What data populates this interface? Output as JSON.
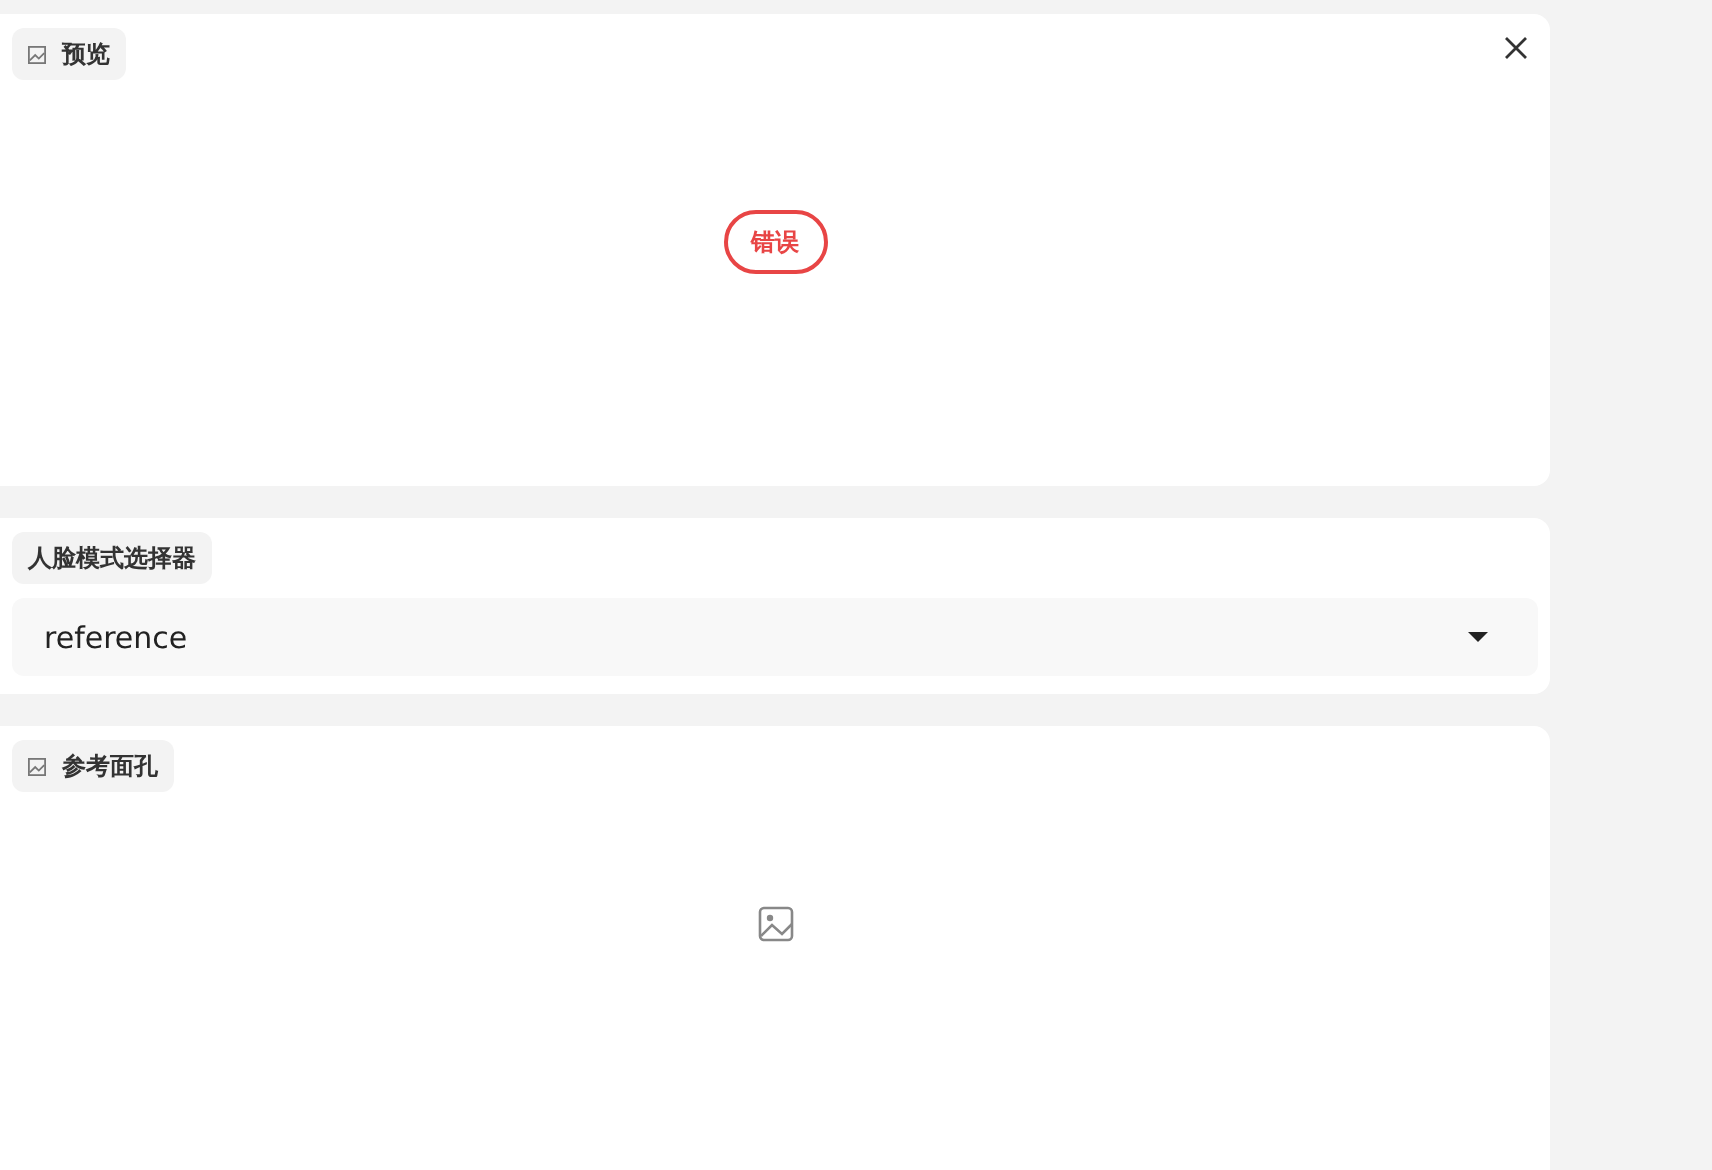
{
  "preview": {
    "label": "预览",
    "error_badge": "错误"
  },
  "face_mode_selector": {
    "label": "人脸模式选择器",
    "value": "reference"
  },
  "reference_face": {
    "label": "参考面孔"
  }
}
